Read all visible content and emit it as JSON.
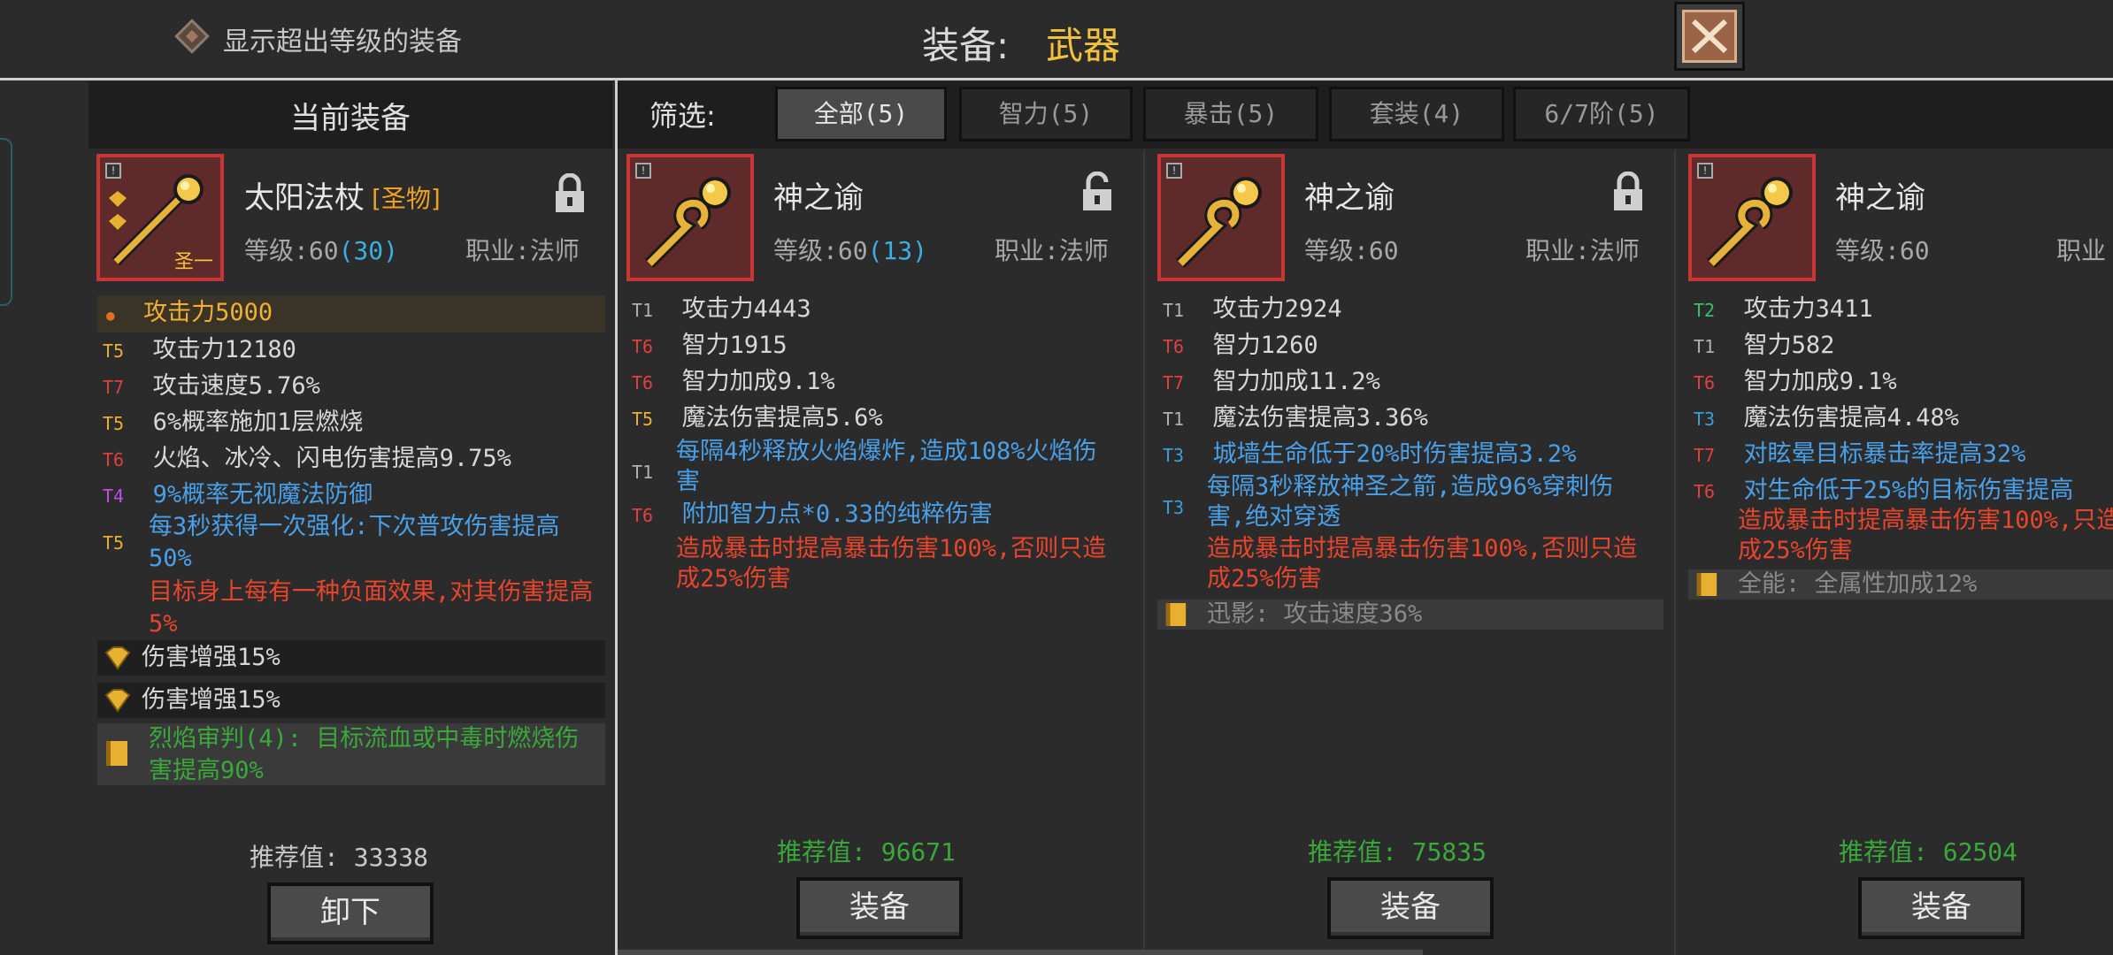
{
  "topbar": {
    "show_over_level": "显示超出等级的装备",
    "title_label": "装备:",
    "title_value": "武器"
  },
  "left": {
    "header": "当前装备",
    "item": {
      "name": "太阳法杖",
      "tag": "[圣物]",
      "level_label": "等级:60",
      "level_extra": "(30)",
      "class_label": "职业:法师",
      "badge": "圣一"
    },
    "stats": [
      {
        "tier": "",
        "text": "攻击力5000",
        "color": "gold"
      },
      {
        "tier": "T5",
        "text": "攻击力12180",
        "color": "white"
      },
      {
        "tier": "T7",
        "text": "攻击速度5.76%",
        "color": "white"
      },
      {
        "tier": "T5",
        "text": "6%概率施加1层燃烧",
        "color": "white"
      },
      {
        "tier": "T6",
        "text": "火焰、冰冷、闪电伤害提高9.75%",
        "color": "white"
      },
      {
        "tier": "T4",
        "text": "9%概率无视魔法防御",
        "color": "blue"
      },
      {
        "tier": "T5",
        "text": "每3秒获得一次强化:下次普攻伤害提高50%",
        "color": "blue"
      },
      {
        "tier": "",
        "text": "目标身上每有一种负面效果,对其伤害提高5%",
        "color": "red"
      }
    ],
    "gems": [
      "伤害增强15%",
      "伤害增强15%"
    ],
    "set_bonus": "烈焰审判(4): 目标流血或中毒时燃烧伤害提高90%",
    "recommend_label": "推荐值:",
    "recommend_value": "33338",
    "button": "卸下"
  },
  "filter": {
    "label": "筛选:",
    "tabs": [
      "全部(5)",
      "智力(5)",
      "暴击(5)",
      "套装(4)",
      "6/7阶(5)"
    ]
  },
  "cards": [
    {
      "name": "神之谕",
      "level_label": "等级:60",
      "level_extra": "(13)",
      "class_label": "职业:法师",
      "stats": [
        {
          "tier": "T1",
          "text": "攻击力4443",
          "color": "white"
        },
        {
          "tier": "T6",
          "text": "智力1915",
          "color": "white"
        },
        {
          "tier": "T6",
          "text": "智力加成9.1%",
          "color": "white"
        },
        {
          "tier": "T5",
          "text": "魔法伤害提高5.6%",
          "color": "white"
        },
        {
          "tier": "T1",
          "text": "每隔4秒释放火焰爆炸,造成108%火焰伤害",
          "color": "blue"
        },
        {
          "tier": "T6",
          "text": "附加智力点*0.33的纯粹伤害",
          "color": "blue"
        },
        {
          "tier": "",
          "text": "造成暴击时提高暴击伤害100%,否则只造成25%伤害",
          "color": "red"
        }
      ],
      "set_bonus": "",
      "recommend_label": "推荐值:",
      "recommend_value": "96671",
      "button": "装备"
    },
    {
      "name": "神之谕",
      "level_label": "等级:60",
      "level_extra": "",
      "class_label": "职业:法师",
      "stats": [
        {
          "tier": "T1",
          "text": "攻击力2924",
          "color": "white"
        },
        {
          "tier": "T6",
          "text": "智力1260",
          "color": "white"
        },
        {
          "tier": "T7",
          "text": "智力加成11.2%",
          "color": "white"
        },
        {
          "tier": "T1",
          "text": "魔法伤害提高3.36%",
          "color": "white"
        },
        {
          "tier": "T3",
          "text": "城墙生命低于20%时伤害提高3.2%",
          "color": "blue"
        },
        {
          "tier": "T3",
          "text": "每隔3秒释放神圣之箭,造成96%穿刺伤害,绝对穿透",
          "color": "blue"
        },
        {
          "tier": "",
          "text": "造成暴击时提高暴击伤害100%,否则只造成25%伤害",
          "color": "red"
        }
      ],
      "set_bonus": "迅影: 攻击速度36%",
      "recommend_label": "推荐值:",
      "recommend_value": "75835",
      "button": "装备"
    },
    {
      "name": "神之谕",
      "level_label": "等级:60",
      "level_extra": "",
      "class_label": "职业",
      "stats": [
        {
          "tier": "T2",
          "text": "攻击力3411",
          "color": "white"
        },
        {
          "tier": "T1",
          "text": "智力582",
          "color": "white"
        },
        {
          "tier": "T6",
          "text": "智力加成9.1%",
          "color": "white"
        },
        {
          "tier": "T3",
          "text": "魔法伤害提高4.48%",
          "color": "white"
        },
        {
          "tier": "T7",
          "text": "对眩晕目标暴击率提高32%",
          "color": "blue"
        },
        {
          "tier": "T6",
          "text": "对生命低于25%的目标伤害提高",
          "color": "blue"
        },
        {
          "tier": "",
          "text": "造成暴击时提高暴击伤害100%,只造成25%伤害",
          "color": "red"
        }
      ],
      "set_bonus": "全能: 全属性加成12%",
      "recommend_label": "推荐值:",
      "recommend_value": "62504",
      "button": "装备"
    }
  ]
}
